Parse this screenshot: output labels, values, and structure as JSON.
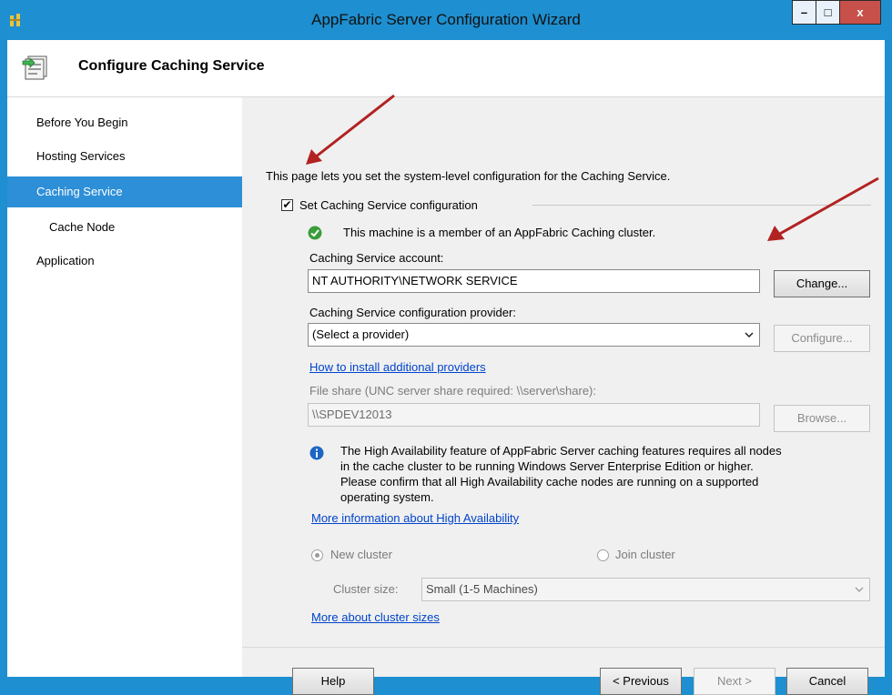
{
  "window": {
    "title": "AppFabric Server Configuration Wizard",
    "minimize_label": "–",
    "maximize_label": "□",
    "close_label": "x"
  },
  "header": {
    "title": "Configure Caching Service"
  },
  "sidebar": {
    "items": [
      {
        "label": "Before You Begin",
        "selected": false
      },
      {
        "label": "Hosting Services",
        "selected": false
      },
      {
        "label": "Caching Service",
        "selected": true
      },
      {
        "label": "Cache Node",
        "selected": false
      },
      {
        "label": "Application",
        "selected": false
      }
    ]
  },
  "main": {
    "intro": "This page lets you set the system-level configuration for the Caching Service.",
    "set_config_label": "Set Caching Service configuration",
    "set_config_checked": true,
    "member_status": "This machine is a member of an AppFabric Caching cluster.",
    "account_label": "Caching Service account:",
    "account_value": "NT AUTHORITY\\NETWORK SERVICE",
    "change_button": "Change...",
    "provider_label": "Caching Service configuration provider:",
    "provider_value": "(Select a provider)",
    "configure_button": "Configure...",
    "install_providers_link": "How to install additional providers",
    "file_share_label": "File share (UNC server share required: \\\\server\\share):",
    "file_share_value": "\\\\SPDEV12013",
    "browse_button": "Browse...",
    "ha_info_lines": [
      "The High Availability feature of AppFabric Server caching features requires all nodes",
      "in the cache cluster to be running Windows Server Enterprise Edition or higher.",
      "Please confirm that all High Availability cache nodes are running on a supported",
      "operating system."
    ],
    "ha_link": "More information about High Availability",
    "new_cluster_label": "New cluster",
    "join_cluster_label": "Join cluster",
    "cluster_size_label": "Cluster size:",
    "cluster_size_value": "Small (1-5 Machines)",
    "cluster_sizes_link": "More about cluster sizes"
  },
  "footer": {
    "help_button": "Help",
    "previous_button": "< Previous",
    "next_button": "Next >",
    "cancel_button": "Cancel"
  },
  "colors": {
    "title_bar": "#1e8fd0",
    "selected_nav": "#2d8fd7",
    "link": "#0044cc",
    "annotation_arrow": "#b22222",
    "status_ok": "#3a9d3a",
    "info": "#1c66c4"
  },
  "icons": [
    "app-icon",
    "wizard-header-icon",
    "check-circle-icon",
    "info-icon",
    "dropdown-chevron-icon"
  ]
}
